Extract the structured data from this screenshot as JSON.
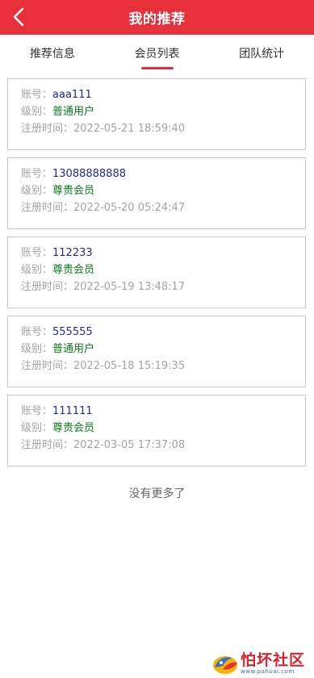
{
  "header": {
    "title": "我的推荐",
    "background": "#e8303a"
  },
  "tabs": [
    {
      "label": "推荐信息",
      "active": false
    },
    {
      "label": "会员列表",
      "active": true
    },
    {
      "label": "团队统计",
      "active": false
    }
  ],
  "labels": {
    "account": "账号：",
    "level": "级别：",
    "registered": "注册时间："
  },
  "members": [
    {
      "account": "aaa111",
      "level": "普通用户",
      "registered": "2022-05-21 18:59:40"
    },
    {
      "account": "13088888888",
      "level": "尊贵会员",
      "registered": "2022-05-20 05:24:47"
    },
    {
      "account": "112233",
      "level": "尊贵会员",
      "registered": "2022-05-19 13:48:17"
    },
    {
      "account": "555555",
      "level": "普通用户",
      "registered": "2022-05-18 15:19:35"
    },
    {
      "account": "111111",
      "level": "尊贵会员",
      "registered": "2022-03-05 17:37:08"
    }
  ],
  "footer": {
    "no_more": "没有更多了"
  },
  "watermark": {
    "text": "怕坏社区",
    "url": "www.pahuai.com"
  }
}
